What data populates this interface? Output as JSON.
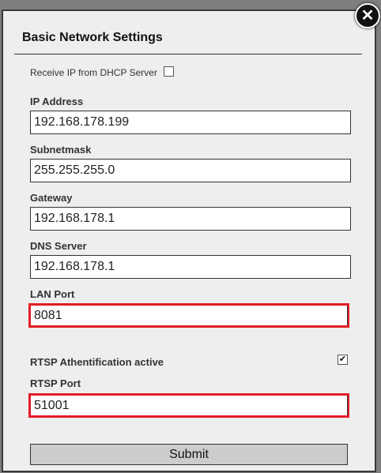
{
  "dialog": {
    "title": "Basic Network Settings",
    "close_icon": "close-icon"
  },
  "dhcp": {
    "label": "Receive IP from DHCP Server",
    "checked": false
  },
  "fields": [
    {
      "label": "IP Address",
      "value": "192.168.178.199"
    },
    {
      "label": "Subnetmask",
      "value": "255.255.255.0"
    },
    {
      "label": "Gateway",
      "value": "192.168.178.1"
    },
    {
      "label": "DNS Server",
      "value": "192.168.178.1"
    },
    {
      "label": "LAN Port",
      "value": "8081",
      "highlighted": true
    },
    {
      "label": "RTSP Port",
      "value": "51001",
      "highlighted": true
    }
  ],
  "rtsp_auth": {
    "label": "RTSP Athentification active",
    "checked": true,
    "check_mark": "✔"
  },
  "submit_label": "Submit",
  "colors": {
    "highlight": "#e31c25",
    "background": "#eeeeee"
  }
}
